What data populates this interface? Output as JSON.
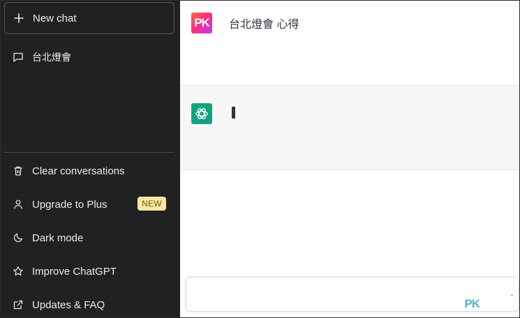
{
  "sidebar": {
    "new_chat_label": "New chat",
    "conversations": [
      {
        "label": "台北燈會"
      }
    ],
    "menu": [
      {
        "label": "Clear conversations",
        "icon": "trash-icon"
      },
      {
        "label": "Upgrade to Plus",
        "icon": "user-icon",
        "badge": "NEW"
      },
      {
        "label": "Dark mode",
        "icon": "moon-icon"
      },
      {
        "label": "Improve ChatGPT",
        "icon": "star-icon"
      },
      {
        "label": "Updates & FAQ",
        "icon": "external-link-icon"
      }
    ]
  },
  "chat": {
    "user_avatar": "PK",
    "user_message": "台北燈會 心得",
    "bot_avatar_icon": "openai-logo-icon"
  },
  "input": {
    "watermark": "PK",
    "placeholder": ""
  },
  "colors": {
    "sidebar_bg": "#202123",
    "bot_bg": "#f7f7f8",
    "openai_green": "#10a37f",
    "badge_bg": "#fae69e"
  }
}
